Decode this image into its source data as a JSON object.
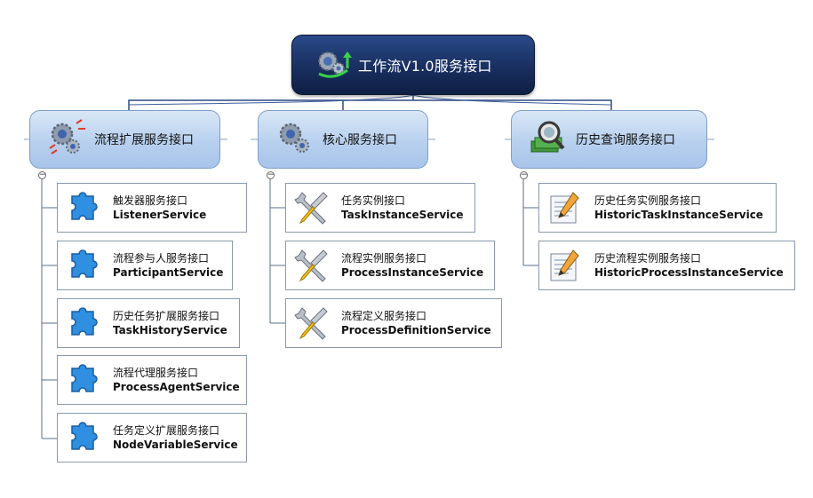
{
  "root": {
    "title": "工作流V1.0服务接口",
    "icon": "gears-arrow-icon"
  },
  "groups": [
    {
      "label": "流程扩展服务接口",
      "icon": "gears-broken-icon",
      "items": [
        {
          "cn": "触发器服务接口",
          "en": "ListenerService",
          "icon": "puzzle-icon"
        },
        {
          "cn": "流程参与人服务接口",
          "en": "ParticipantService",
          "icon": "puzzle-icon"
        },
        {
          "cn": "历史任务扩展服务接口",
          "en": "TaskHistoryService",
          "icon": "puzzle-icon"
        },
        {
          "cn": "流程代理服务接口",
          "en": "ProcessAgentService",
          "icon": "puzzle-icon"
        },
        {
          "cn": "任务定义扩展服务接口",
          "en": "NodeVariableService",
          "icon": "puzzle-icon"
        }
      ]
    },
    {
      "label": "核心服务接口",
      "icon": "gears-icon",
      "items": [
        {
          "cn": "任务实例接口",
          "en": "TaskInstanceService",
          "icon": "tools-icon"
        },
        {
          "cn": "流程实例服务接口",
          "en": "ProcessInstanceService",
          "icon": "tools-icon"
        },
        {
          "cn": "流程定义服务接口",
          "en": "ProcessDefinitionService",
          "icon": "tools-icon"
        }
      ]
    },
    {
      "label": "历史查询服务接口",
      "icon": "money-search-icon",
      "items": [
        {
          "cn": "历史任务实例服务接口",
          "en": "HistoricTaskInstanceService",
          "icon": "notepad-pencil-icon"
        },
        {
          "cn": "历史流程实例服务接口",
          "en": "HistoricProcessInstanceService",
          "icon": "notepad-pencil-icon"
        }
      ]
    }
  ],
  "colors": {
    "root": "#1b3366",
    "group": "#b8d0ee",
    "line": "#5a6f8f"
  }
}
